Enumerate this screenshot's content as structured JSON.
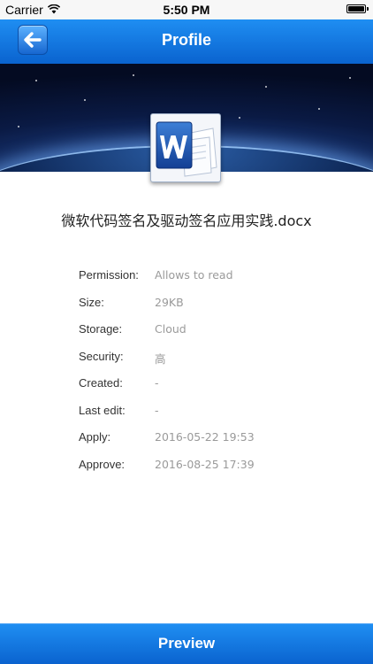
{
  "status_bar": {
    "carrier": "Carrier",
    "time": "5:50 PM",
    "battery_level": 1.0,
    "wifi_icon": "wifi-icon",
    "battery_icon": "battery-icon"
  },
  "nav": {
    "title": "Profile",
    "back_icon": "back-arrow-icon"
  },
  "file": {
    "icon": "word-document-icon",
    "name": "微软代码签名及驱动签名应用实践.docx"
  },
  "details": [
    {
      "label": "Permission:",
      "value": "Allows to read"
    },
    {
      "label": "Size:",
      "value": "29KB"
    },
    {
      "label": "Storage:",
      "value": "Cloud"
    },
    {
      "label": "Security:",
      "value": "高"
    },
    {
      "label": "Created:",
      "value": "-"
    },
    {
      "label": "Last edit:",
      "value": "-"
    },
    {
      "label": "Apply:",
      "value": "2016-05-22 19:53"
    },
    {
      "label": "Approve:",
      "value": "2016-08-25 17:39"
    }
  ],
  "footer": {
    "preview_label": "Preview"
  },
  "colors": {
    "accent_blue": "#1a7fe8",
    "label_text": "#333333",
    "value_text": "#9a9a9a"
  }
}
